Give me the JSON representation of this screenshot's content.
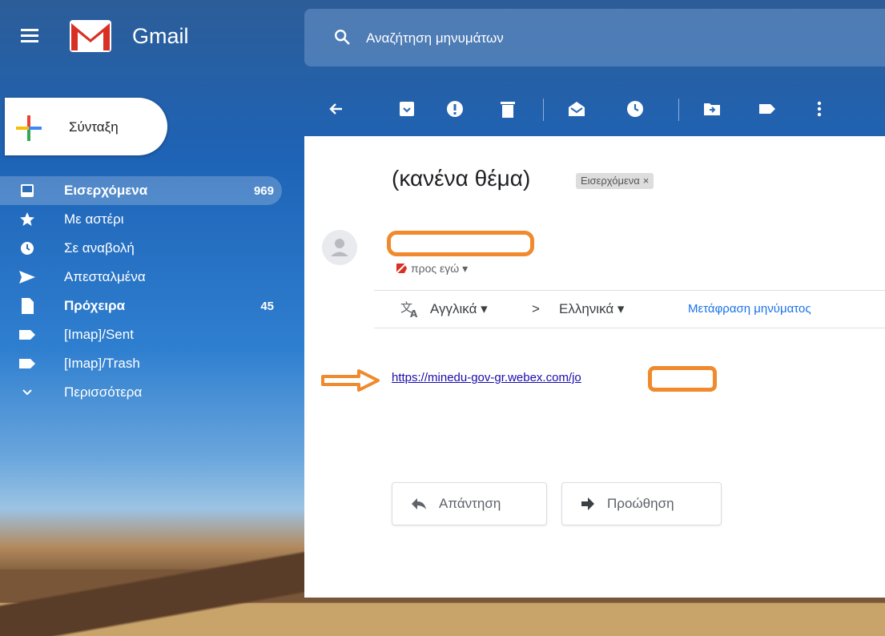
{
  "app": {
    "title": "Gmail"
  },
  "search": {
    "placeholder": "Αναζήτηση μηνυμάτων"
  },
  "compose": {
    "label": "Σύνταξη"
  },
  "sidebar": {
    "items": [
      {
        "label": "Εισερχόμενα",
        "count": "969",
        "icon": "inbox-icon",
        "bold": true,
        "active": true
      },
      {
        "label": "Με αστέρι",
        "count": "",
        "icon": "star-icon"
      },
      {
        "label": "Σε αναβολή",
        "count": "",
        "icon": "clock-icon"
      },
      {
        "label": "Απεσταλμένα",
        "count": "",
        "icon": "send-icon"
      },
      {
        "label": "Πρόχειρα",
        "count": "45",
        "icon": "draft-icon",
        "bold": true
      },
      {
        "label": "[Imap]/Sent",
        "count": "",
        "icon": "label-icon"
      },
      {
        "label": "[Imap]/Trash",
        "count": "",
        "icon": "label-icon"
      },
      {
        "label": "Περισσότερα",
        "count": "",
        "icon": "chevron-down-icon"
      }
    ]
  },
  "toolbar": {
    "icons": [
      "back-icon",
      "archive-icon",
      "report-spam-icon",
      "delete-icon",
      "mark-unread-icon",
      "snooze-icon",
      "move-to-icon",
      "labels-icon",
      "more-icon"
    ]
  },
  "message": {
    "subject": "(κανένα θέμα)",
    "label_chip": "Εισερχόμενα",
    "label_chip_close": "×",
    "to_line": "προς εγώ ▾",
    "link_text": "https://minedu-gov-gr.webex.com/jo"
  },
  "translate": {
    "from_lang": "Αγγλικά ▾",
    "separator": ">",
    "to_lang": "Ελληνικά ▾",
    "action": "Μετάφραση μηνύματος"
  },
  "actions": {
    "reply": "Απάντηση",
    "forward": "Προώθηση"
  },
  "colors": {
    "annotation": "#f08a2c",
    "link": "#1a0dab",
    "accent_blue": "#1a73e8"
  }
}
